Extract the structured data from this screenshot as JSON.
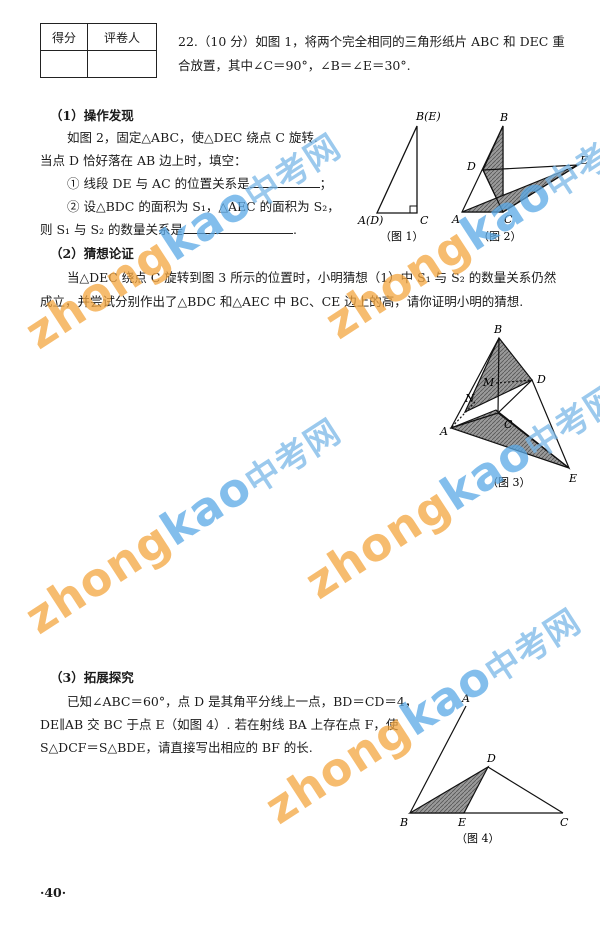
{
  "score_table": {
    "col1": "得分",
    "col2": "评卷人"
  },
  "problem": {
    "line1": "22.（10 分）如图 1，将两个完全相同的三角形纸片 ABC 和 DEC 重",
    "line2": "合放置，其中∠C＝90°，∠B＝∠E＝30°."
  },
  "part1": {
    "heading": "（1）操作发现",
    "l1": "如图 2，固定△ABC，使△DEC 绕点 C 旋转.",
    "l2": "当点 D 恰好落在 AB 边上时，填空：",
    "q1": "① 线段 DE 与 AC 的位置关系是",
    "q1_end": "；",
    "q2": "② 设△BDC 的面积为 S₁，△AEC 的面积为 S₂，",
    "q3": "则 S₁ 与 S₂ 的数量关系是",
    "q3_end": "."
  },
  "part2": {
    "heading": "（2）猜想论证",
    "l1": "当△DEC 绕点 C 旋转到图 3 所示的位置时，小明猜想（1）中 S₁ 与 S₂ 的数量关系仍然",
    "l2": "成立，并尝试分别作出了△BDC 和△AEC 中 BC、CE 边上的高，请你证明小明的猜想."
  },
  "part3": {
    "heading": "（3）拓展探究",
    "l1": "已知∠ABC＝60°，点 D 是其角平分线上一点，BD＝CD＝4，",
    "l2": "DE∥AB 交 BC 于点 E（如图 4）. 若在射线 BA 上存在点 F，使",
    "l3": "S△DCF＝S△BDE，请直接写出相应的 BF 的长."
  },
  "fig1": {
    "caption": "（图 1）",
    "B": "B(E)",
    "A": "A(D)",
    "C": "C"
  },
  "fig2": {
    "caption": "（图 2）",
    "B": "B",
    "D": "D",
    "E": "E",
    "A": "A",
    "C": "C"
  },
  "fig3": {
    "caption": "（图 3）",
    "B": "B",
    "M": "M",
    "N": "N",
    "D": "D",
    "A": "A",
    "C": "C",
    "E": "E"
  },
  "fig4": {
    "caption": "（图 4）",
    "A": "A",
    "D": "D",
    "B": "B",
    "E": "E",
    "C": "C"
  },
  "watermark": {
    "latin_a": "zhong",
    "latin_b": "kao",
    "cn": "中考网"
  },
  "page_number": "·40·"
}
